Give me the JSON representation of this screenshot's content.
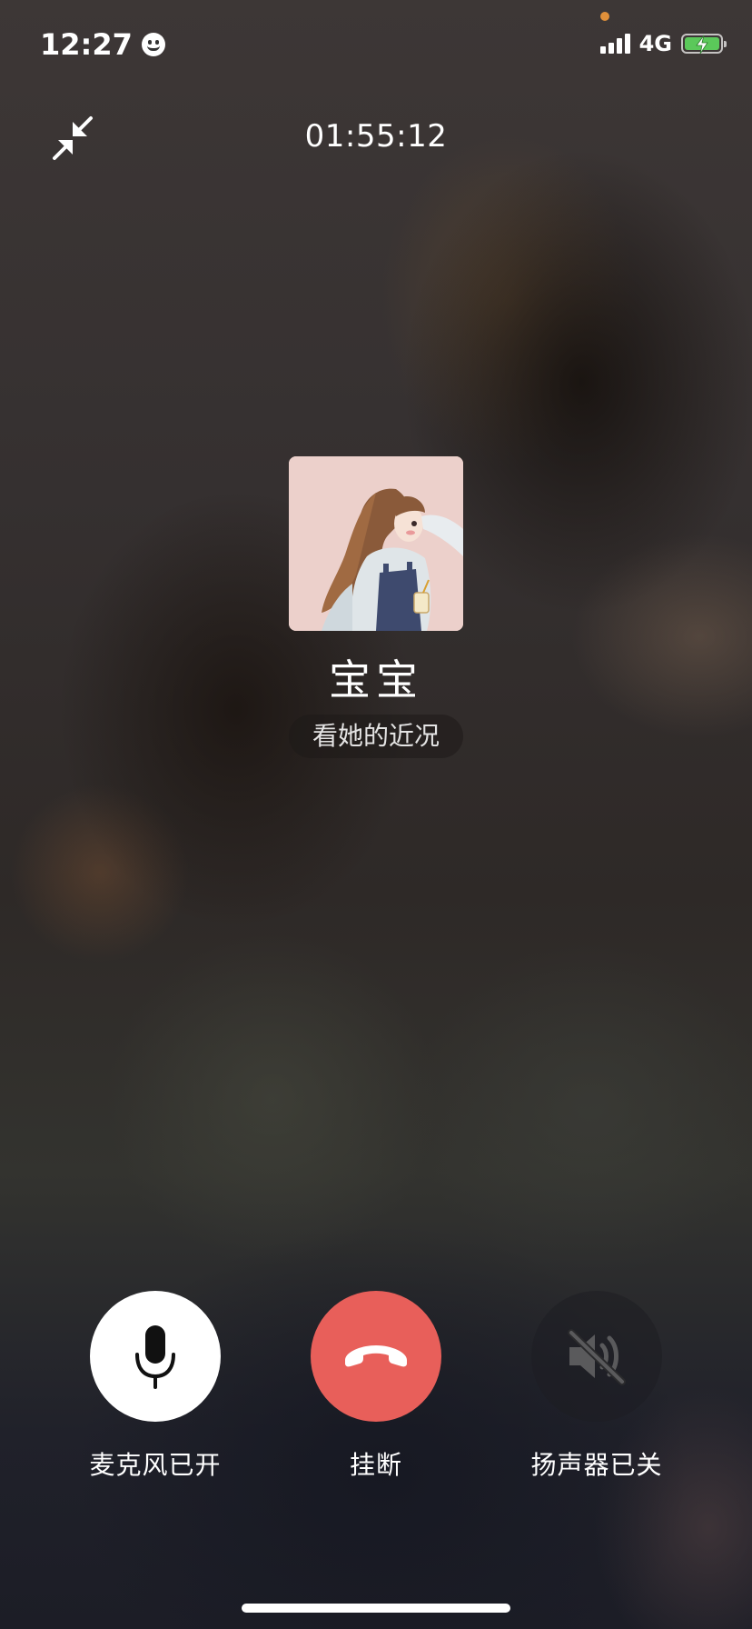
{
  "status_bar": {
    "time": "12:27",
    "network": "4G",
    "battery_charging": true
  },
  "call": {
    "duration": "01:55:12",
    "contact_name": "宝宝",
    "status_link": "看她的近况"
  },
  "controls": {
    "mic_label": "麦克风已开",
    "hangup_label": "挂断",
    "speaker_label": "扬声器已关"
  },
  "colors": {
    "hangup": "#e85f5a",
    "battery": "#5bc85a",
    "privacy_dot": "#e0903a"
  },
  "icons": {
    "minimize": "minimize-arrows-icon",
    "mic": "microphone-icon",
    "hangup": "phone-hangup-icon",
    "speaker": "speaker-muted-icon"
  }
}
